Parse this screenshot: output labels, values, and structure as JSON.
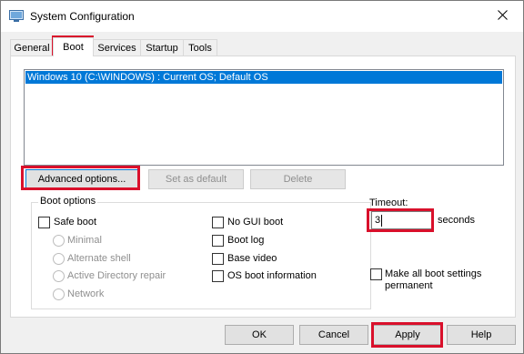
{
  "window": {
    "title": "System Configuration",
    "close_icon": "close-icon",
    "app_icon": "system-config-icon"
  },
  "tabs": [
    {
      "label": "General",
      "active": false
    },
    {
      "label": "Boot",
      "active": true
    },
    {
      "label": "Services",
      "active": false
    },
    {
      "label": "Startup",
      "active": false
    },
    {
      "label": "Tools",
      "active": false
    }
  ],
  "os_list": {
    "items": [
      "Windows 10 (C:\\WINDOWS) : Current OS; Default OS"
    ]
  },
  "list_buttons": {
    "advanced": "Advanced options...",
    "set_default": "Set as default",
    "delete": "Delete"
  },
  "boot_options": {
    "title": "Boot options",
    "safe_boot": "Safe boot",
    "minimal": "Minimal",
    "alternate_shell": "Alternate shell",
    "active_directory_repair": "Active Directory repair",
    "network": "Network",
    "no_gui_boot": "No GUI boot",
    "boot_log": "Boot log",
    "base_video": "Base video",
    "os_boot_information": "OS boot information"
  },
  "timeout": {
    "label": "Timeout:",
    "value": "3",
    "unit": "seconds"
  },
  "make_permanent": {
    "line1": "Make all boot settings",
    "line2": "permanent"
  },
  "footer": {
    "ok": "OK",
    "cancel": "Cancel",
    "apply": "Apply",
    "help": "Help"
  },
  "colors": {
    "highlight": "#d9102b",
    "selection": "#0078d7"
  }
}
